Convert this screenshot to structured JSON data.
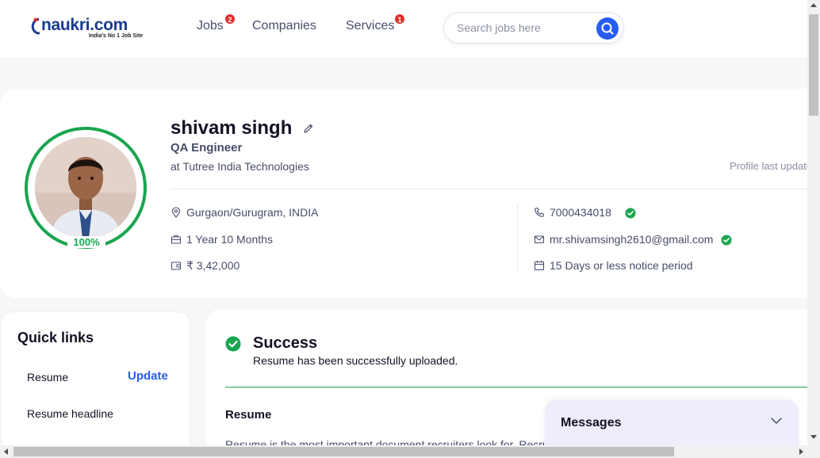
{
  "header": {
    "logo_text": "naukri.com",
    "logo_tagline": "India's No 1 Job Site",
    "nav": [
      {
        "label": "Jobs",
        "badge": "2"
      },
      {
        "label": "Companies"
      },
      {
        "label": "Services",
        "badge": "1"
      }
    ],
    "search": {
      "placeholder": "Search jobs here",
      "icon": "search-icon"
    }
  },
  "profile": {
    "name": "shivam singh",
    "designation": "QA Engineer",
    "company": "at Tutree India Technologies",
    "last_updated": "Profile last updated",
    "completion": "100%",
    "completion_fraction": 1.0,
    "details_left": [
      {
        "icon": "location-icon",
        "text": "Gurgaon/Gurugram, INDIA"
      },
      {
        "icon": "briefcase-icon",
        "text": "1 Year 10 Months"
      },
      {
        "icon": "wallet-icon",
        "text": "₹ 3,42,000"
      }
    ],
    "details_right": [
      {
        "icon": "phone-icon",
        "text": "7000434018",
        "verified": true
      },
      {
        "icon": "mail-icon",
        "text": "mr.shivamsingh2610@gmail.com",
        "verified": true
      },
      {
        "icon": "calendar-icon",
        "text": "15 Days or less notice period"
      }
    ]
  },
  "quick_links": {
    "title": "Quick links",
    "items": [
      {
        "label": "Resume",
        "action": "Update"
      },
      {
        "label": "Resume headline"
      }
    ]
  },
  "success": {
    "title": "Success",
    "message": "Resume has been successfully uploaded.",
    "section_title": "Resume",
    "section_desc": "Resume is the most important document recruiters look for. Recruiters"
  },
  "messages": {
    "title": "Messages"
  },
  "colors": {
    "brand_blue": "#275df5",
    "success_green": "#1aa54f",
    "badge_red": "#e0302a",
    "text_dark": "#121224",
    "text_muted": "#474d6a"
  }
}
